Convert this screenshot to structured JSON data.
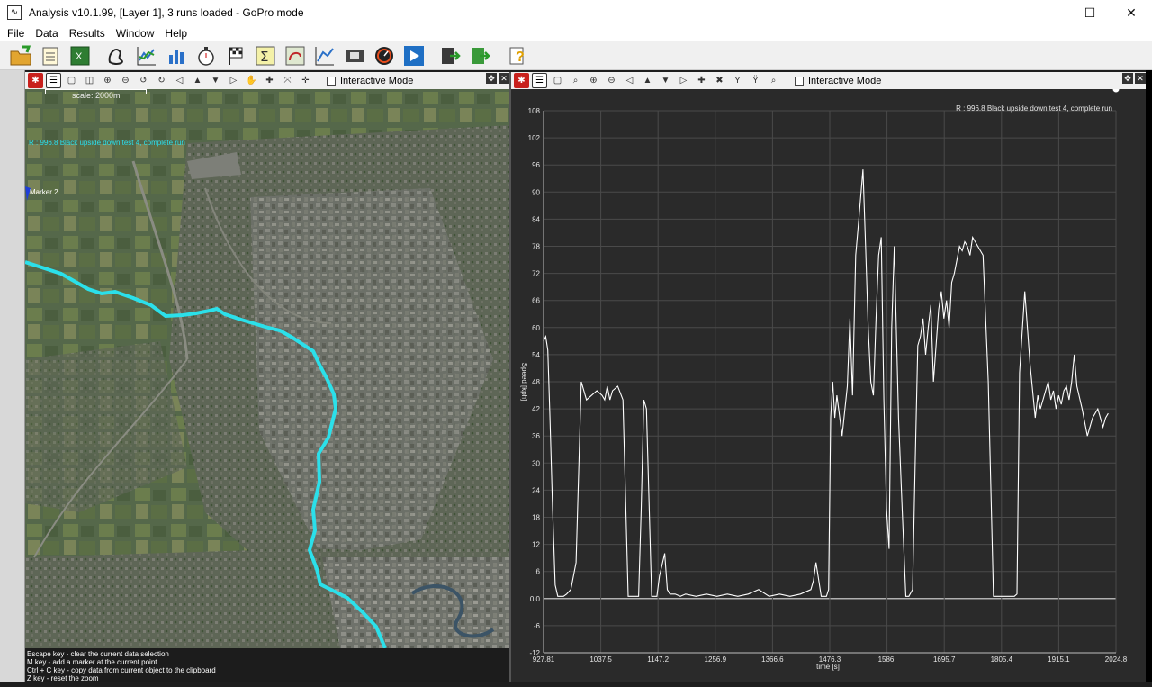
{
  "window": {
    "title": "Analysis v10.1.99, [Layer 1], 3 runs loaded - GoPro mode",
    "minimize": "—",
    "maximize": "☐",
    "close": "✕"
  },
  "menu": [
    "File",
    "Data",
    "Results",
    "Window",
    "Help"
  ],
  "toolbar_icons": [
    "open-folder-icon",
    "notepad-icon",
    "spreadsheet-icon",
    "track-outline-icon",
    "line-chart-icon",
    "bar-chart-icon",
    "stopwatch-icon",
    "checkered-flag-icon",
    "sigma-icon",
    "track-grid-icon",
    "xy-plot-icon",
    "film-icon",
    "gauge-icon",
    "play-icon",
    "export-icon",
    "export-table-icon",
    "help-icon"
  ],
  "map_panel": {
    "interactive_mode": "Interactive Mode",
    "scale": "scale: 2000m",
    "run_label": "R : 996.8 Black upside down test 4, complete run",
    "marker": "Marker 2",
    "route_color": "#2be0ea",
    "status_lines": [
      "Escape key - clear the current data selection",
      "M key - add a marker at the current point",
      "Ctrl + C key - copy data from current object to the clipboard",
      "Z key - reset the zoom"
    ]
  },
  "chart_panel": {
    "interactive_mode": "Interactive Mode",
    "chart_data": {
      "type": "line",
      "title": "R : 996.8 Black upside down test 4, complete run",
      "xlabel": "time [s]",
      "ylabel": "Speed [kph]",
      "xlim": [
        927.81,
        2024.8
      ],
      "ylim": [
        -12,
        108
      ],
      "x_ticks": [
        "927.81",
        "1037.5",
        "1147.2",
        "1256.9",
        "1366.6",
        "1476.3",
        "1586.",
        "1695.7",
        "1805.4",
        "1915.1",
        "2024.8"
      ],
      "y_ticks": [
        "108",
        "102",
        "96",
        "90",
        "84",
        "78",
        "72",
        "66",
        "60",
        "54",
        "48",
        "42",
        "36",
        "30",
        "24",
        "18",
        "12",
        "6",
        "0.0",
        "-6",
        "-12"
      ],
      "line_color": "#ffffff",
      "series": [
        {
          "x": [
            927.8,
            932,
            936,
            940,
            945,
            950,
            955,
            960,
            966,
            972,
            980,
            990,
            1000,
            1010,
            1020,
            1030,
            1040,
            1045,
            1050,
            1055,
            1060,
            1070,
            1080,
            1090,
            1100,
            1105,
            1110,
            1115,
            1120,
            1125,
            1135,
            1140,
            1145,
            1150,
            1160,
            1165,
            1170,
            1180,
            1190,
            1200,
            1220,
            1240,
            1260,
            1280,
            1300,
            1320,
            1340,
            1360,
            1380,
            1400,
            1420,
            1440,
            1445,
            1450,
            1460,
            1470,
            1474,
            1478,
            1482,
            1486,
            1490,
            1500,
            1510,
            1515,
            1520,
            1526,
            1532,
            1540,
            1545,
            1550,
            1555,
            1560,
            1565,
            1570,
            1575,
            1580,
            1585,
            1590,
            1595,
            1600,
            1608,
            1615,
            1622,
            1628,
            1635,
            1640,
            1645,
            1650,
            1655,
            1660,
            1665,
            1670,
            1675,
            1685,
            1690,
            1695,
            1700,
            1705,
            1710,
            1715,
            1720,
            1725,
            1730,
            1735,
            1740,
            1745,
            1750,
            1760,
            1770,
            1780,
            1790,
            1800,
            1810,
            1815,
            1820,
            1825,
            1830,
            1835,
            1840,
            1850,
            1860,
            1870,
            1875,
            1880,
            1885,
            1890,
            1895,
            1900,
            1905,
            1910,
            1915,
            1920,
            1925,
            1930,
            1935,
            1940,
            1945,
            1950,
            1960,
            1970,
            1980,
            1990,
            2000,
            2005,
            2010,
            2015,
            2020,
            2024.8
          ],
          "y": [
            57,
            58,
            55,
            40,
            20,
            3,
            0.5,
            0.5,
            0.5,
            1,
            2,
            8,
            48,
            44,
            45,
            46,
            45,
            44,
            47,
            44,
            46,
            47,
            44,
            0.5,
            0.5,
            0.5,
            0.5,
            20,
            44,
            42,
            0.5,
            0.5,
            0.5,
            5,
            10,
            2,
            1,
            1,
            0.5,
            1,
            0.5,
            1,
            0.5,
            1,
            0.5,
            1,
            2,
            0.5,
            1,
            0.5,
            1,
            2,
            4,
            8,
            0.5,
            0.5,
            2,
            40,
            48,
            40,
            45,
            36,
            47,
            62,
            45,
            76,
            84,
            95,
            78,
            60,
            48,
            45,
            62,
            76,
            80,
            44,
            20,
            11,
            60,
            78,
            40,
            20,
            0.5,
            0.5,
            2,
            30,
            56,
            58,
            62,
            54,
            60,
            65,
            48,
            64,
            68,
            62,
            66,
            60,
            70,
            72,
            75,
            78,
            77,
            79,
            78,
            76,
            80,
            78,
            76,
            48,
            0.5,
            0.5,
            0.5,
            0.5,
            0.5,
            0.5,
            0.5,
            1,
            50,
            68,
            52,
            40,
            45,
            42,
            44,
            46,
            48,
            44,
            46,
            42,
            45,
            43,
            46,
            47,
            44,
            48,
            54,
            47,
            42,
            36,
            40,
            42,
            38,
            40,
            41
          ],
          "point_at_end": true
        }
      ]
    }
  }
}
